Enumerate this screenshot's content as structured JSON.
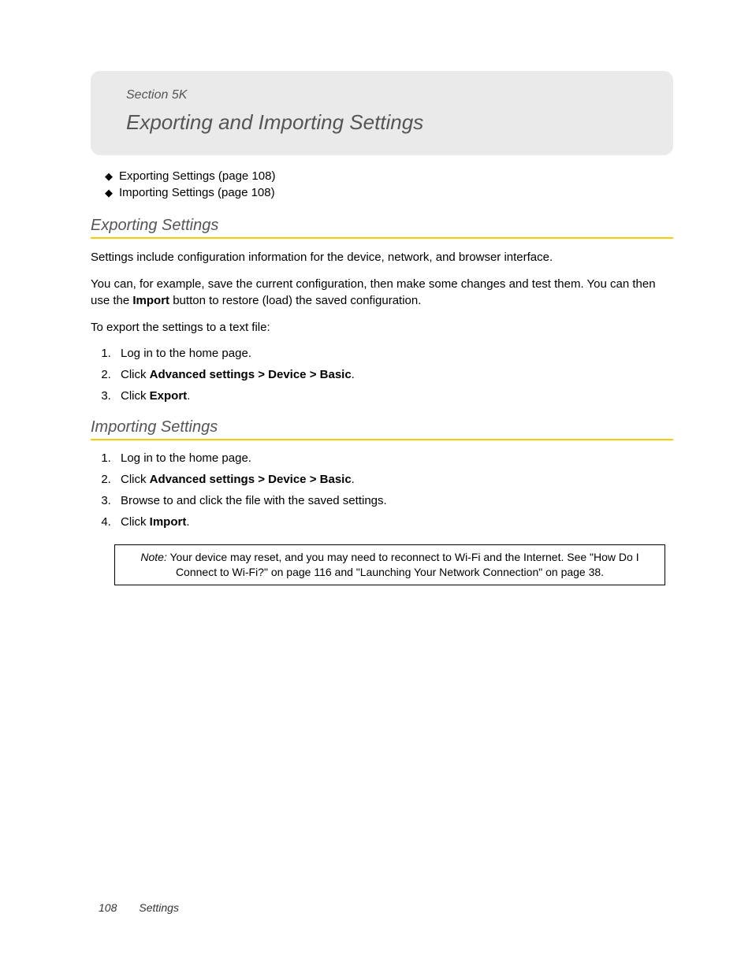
{
  "header": {
    "section_label": "Section 5K",
    "title": "Exporting and Importing Settings"
  },
  "toc": {
    "items": [
      "Exporting Settings (page 108)",
      "Importing Settings (page 108)"
    ]
  },
  "exporting": {
    "heading": "Exporting Settings",
    "para1": "Settings include configuration information for the device, network, and browser interface.",
    "para2_a": "You can, for example, save the current configuration, then make some changes and test them. You can then use the ",
    "para2_bold": "Import",
    "para2_b": " button to restore (load) the saved configuration.",
    "para3": "To export the settings to a text file:",
    "steps": {
      "s1": "Log in to the home page.",
      "s2_a": "Click ",
      "s2_b1": "Advanced settings",
      "s2_gt1": " > ",
      "s2_b2": "Device",
      "s2_gt2": " > ",
      "s2_b3": "Basic",
      "s2_end": ".",
      "s3_a": "Click ",
      "s3_b": "Export",
      "s3_end": "."
    }
  },
  "importing": {
    "heading": "Importing Settings",
    "steps": {
      "s1": "Log in to the home page.",
      "s2_a": "Click ",
      "s2_b1": "Advanced settings",
      "s2_gt1": " > ",
      "s2_b2": "Device",
      "s2_gt2": " > ",
      "s2_b3": "Basic",
      "s2_end": ".",
      "s3": "Browse to and click the file with the saved settings.",
      "s4_a": "Click ",
      "s4_b": "Import",
      "s4_end": "."
    }
  },
  "note": {
    "label": "Note:",
    "text": "  Your device may reset, and you may need to reconnect to Wi-Fi and the Internet. See \"How Do I Connect to Wi-Fi?\" on page 116 and \"Launching Your Network Connection\" on page 38."
  },
  "footer": {
    "page": "108",
    "chapter": "Settings"
  }
}
